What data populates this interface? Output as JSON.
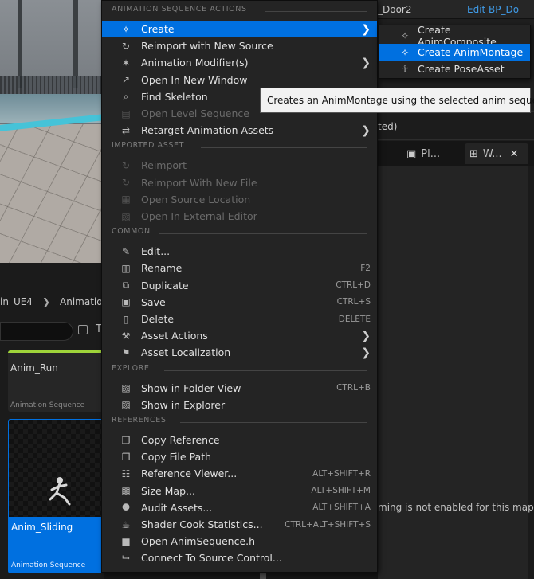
{
  "window": {
    "title": ""
  },
  "viewport": {},
  "content_browser": {
    "breadcrumb": [
      {
        "label": "in_UE4"
      },
      {
        "label": "Animation"
      }
    ],
    "assets": [
      {
        "name": "Anim_Run",
        "type": "Animation Sequence",
        "selected": false
      },
      {
        "name": "Anim_Sliding",
        "type": "Animation Sequence",
        "selected": true
      }
    ]
  },
  "right_panel": {
    "row1_label": "_Door2",
    "row1_link": "Edit BP_Do",
    "row2_text": "ted)",
    "tabs": [
      {
        "label": "Pl...",
        "icon": "cube-icon"
      },
      {
        "label": "W...",
        "icon": "grid-icon"
      }
    ],
    "streaming_message": "ming is not enabled for this map"
  },
  "context_menu": {
    "sections": [
      {
        "header": "ANIMATION SEQUENCE ACTIONS",
        "items": [
          {
            "label": "Create",
            "icon": "create-icon",
            "submenu": true,
            "highlighted": true,
            "enabled": true
          },
          {
            "label": "Reimport with New Source",
            "icon": "reimport-icon",
            "enabled": true
          },
          {
            "label": "Animation Modifier(s)",
            "icon": "modifier-icon",
            "submenu": true,
            "enabled": true
          },
          {
            "label": "Open In New Window",
            "icon": "open-window-icon",
            "enabled": true
          },
          {
            "label": "Find Skeleton",
            "icon": "find-skeleton-icon",
            "enabled": true
          },
          {
            "label": "Open Level Sequence",
            "icon": "level-sequence-icon",
            "enabled": false
          },
          {
            "label": "Retarget Animation Assets",
            "icon": "retarget-icon",
            "submenu": true,
            "enabled": true
          }
        ]
      },
      {
        "header": "IMPORTED ASSET",
        "items": [
          {
            "label": "Reimport",
            "icon": "reimport-icon",
            "enabled": false
          },
          {
            "label": "Reimport With New File",
            "icon": "reimport-icon",
            "enabled": false
          },
          {
            "label": "Open Source Location",
            "icon": "folder-icon",
            "enabled": false
          },
          {
            "label": "Open In External Editor",
            "icon": "external-editor-icon",
            "enabled": false
          }
        ]
      },
      {
        "header": "COMMON",
        "items": [
          {
            "label": "Edit...",
            "icon": "pencil-icon",
            "enabled": true
          },
          {
            "label": "Rename",
            "icon": "rename-icon",
            "shortcut": "F2",
            "enabled": true
          },
          {
            "label": "Duplicate",
            "icon": "duplicate-icon",
            "shortcut": "CTRL+D",
            "enabled": true
          },
          {
            "label": "Save",
            "icon": "save-icon",
            "shortcut": "CTRL+S",
            "enabled": true
          },
          {
            "label": "Delete",
            "icon": "trash-icon",
            "shortcut": "DELETE",
            "enabled": true
          },
          {
            "label": "Asset Actions",
            "icon": "wrench-icon",
            "submenu": true,
            "enabled": true
          },
          {
            "label": "Asset Localization",
            "icon": "flag-icon",
            "submenu": true,
            "enabled": true
          }
        ]
      },
      {
        "header": "EXPLORE",
        "items": [
          {
            "label": "Show in Folder View",
            "icon": "folder-search-icon",
            "shortcut": "CTRL+B",
            "enabled": true
          },
          {
            "label": "Show in Explorer",
            "icon": "folder-search-icon",
            "enabled": true
          }
        ]
      },
      {
        "header": "REFERENCES",
        "items": [
          {
            "label": "Copy Reference",
            "icon": "copy-icon",
            "enabled": true
          },
          {
            "label": "Copy File Path",
            "icon": "copy-icon",
            "enabled": true
          },
          {
            "label": "Reference Viewer...",
            "icon": "reference-viewer-icon",
            "shortcut": "ALT+SHIFT+R",
            "enabled": true
          },
          {
            "label": "Size Map...",
            "icon": "size-map-icon",
            "shortcut": "ALT+SHIFT+M",
            "enabled": true
          },
          {
            "label": "Audit Assets...",
            "icon": "audit-icon",
            "shortcut": "ALT+SHIFT+A",
            "enabled": true
          },
          {
            "label": "Shader Cook Statistics...",
            "icon": "shader-icon",
            "shortcut": "CTRL+ALT+SHIFT+S",
            "enabled": true
          },
          {
            "label": "Open AnimSequence.h",
            "icon": "cpp-icon",
            "enabled": true
          },
          {
            "label": "Connect To Source Control...",
            "icon": "source-control-icon",
            "enabled": true
          }
        ]
      }
    ]
  },
  "submenu": {
    "items": [
      {
        "label": "Create AnimComposite",
        "icon": "anim-composite-icon",
        "highlighted": false
      },
      {
        "label": "Create AnimMontage",
        "icon": "anim-montage-icon",
        "highlighted": true
      },
      {
        "label": "Create PoseAsset",
        "icon": "pose-asset-icon",
        "highlighted": false
      }
    ]
  },
  "tooltip": {
    "text": "Creates an AnimMontage using the selected anim sequence."
  },
  "colors": {
    "highlight": "#0070e0",
    "menu_bg": "#242424",
    "link": "#3f9ae6"
  }
}
